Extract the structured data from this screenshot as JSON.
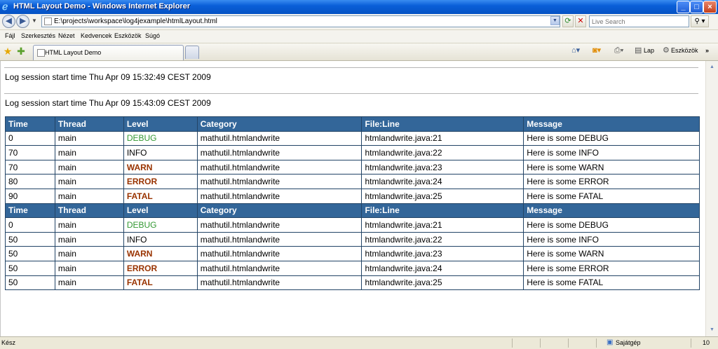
{
  "window": {
    "title": "HTML Layout Demo - Windows Internet Explorer",
    "buttons": {
      "minimize": "_",
      "maximize": "□",
      "close": "×"
    }
  },
  "address": {
    "url": "E:\\projects\\workspace\\log4jexample\\htmlLayout.html",
    "search_placeholder": "Live Search"
  },
  "menu": [
    "Fájl",
    "Szerkesztés",
    "Nézet",
    "Kedvencek",
    "Eszközök",
    "Súgó"
  ],
  "tabs": {
    "active": "HTML Layout Demo"
  },
  "command_bar": {
    "page": "Lap",
    "tools": "Eszközök",
    "more": "»"
  },
  "content": {
    "sessions": [
      "Log session start time Thu Apr 09 15:32:49 CEST 2009",
      "Log session start time Thu Apr 09 15:43:09 CEST 2009"
    ],
    "columns": [
      "Time",
      "Thread",
      "Level",
      "Category",
      "File:Line",
      "Message"
    ],
    "block1": [
      [
        "0",
        "main",
        "DEBUG",
        "mathutil.htmlandwrite",
        "htmlandwrite.java:21",
        "Here is some DEBUG"
      ],
      [
        "70",
        "main",
        "INFO",
        "mathutil.htmlandwrite",
        "htmlandwrite.java:22",
        "Here is some INFO"
      ],
      [
        "70",
        "main",
        "WARN",
        "mathutil.htmlandwrite",
        "htmlandwrite.java:23",
        "Here is some WARN"
      ],
      [
        "80",
        "main",
        "ERROR",
        "mathutil.htmlandwrite",
        "htmlandwrite.java:24",
        "Here is some ERROR"
      ],
      [
        "90",
        "main",
        "FATAL",
        "mathutil.htmlandwrite",
        "htmlandwrite.java:25",
        "Here is some FATAL"
      ]
    ],
    "block2": [
      [
        "0",
        "main",
        "DEBUG",
        "mathutil.htmlandwrite",
        "htmlandwrite.java:21",
        "Here is some DEBUG"
      ],
      [
        "50",
        "main",
        "INFO",
        "mathutil.htmlandwrite",
        "htmlandwrite.java:22",
        "Here is some INFO"
      ],
      [
        "50",
        "main",
        "WARN",
        "mathutil.htmlandwrite",
        "htmlandwrite.java:23",
        "Here is some WARN"
      ],
      [
        "50",
        "main",
        "ERROR",
        "mathutil.htmlandwrite",
        "htmlandwrite.java:24",
        "Here is some ERROR"
      ],
      [
        "50",
        "main",
        "FATAL",
        "mathutil.htmlandwrite",
        "htmlandwrite.java:25",
        "Here is some FATAL"
      ]
    ]
  },
  "status": {
    "text": "Kész",
    "zone": "Sajátgép",
    "zoom": "10"
  },
  "colors": {
    "header_bg": "#336699",
    "debug": "#339933",
    "warn_error_fatal": "#993300"
  }
}
